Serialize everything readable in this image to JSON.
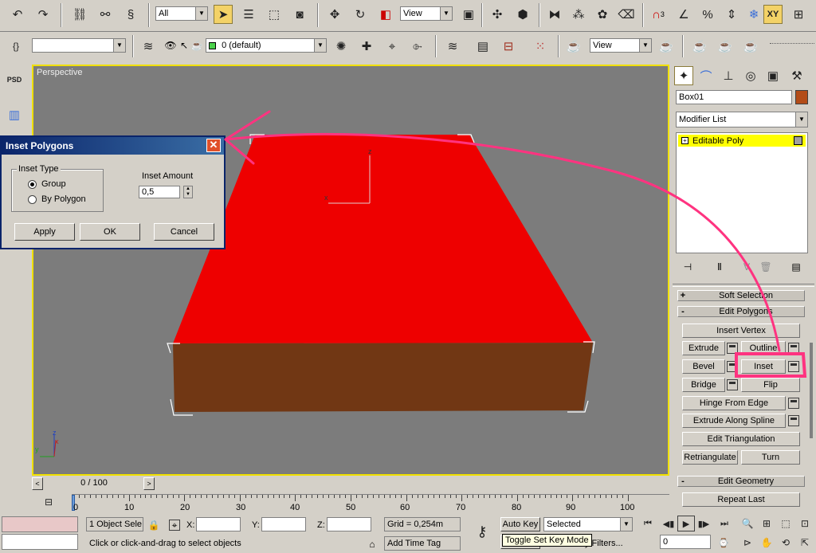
{
  "toolbar1": {
    "selection_filter": "All",
    "ref_coord": "View",
    "icons": [
      "undo-icon",
      "redo-icon",
      "link-icon",
      "unlink-icon",
      "bind-spacewarp-icon",
      "select-icon",
      "select-by-name-icon",
      "rect-region-icon",
      "window-crossing-icon",
      "move-icon",
      "rotate-icon",
      "scale-icon",
      "pivot-icon",
      "manipulate-icon",
      "snap-3-icon",
      "angle-snap-icon",
      "percent-snap-icon",
      "spinner-snap-icon",
      "named-selection-icon",
      "mirror-icon",
      "align-icon",
      "xy-icon",
      "layer-icon"
    ],
    "axis_constraint": "XY",
    "snap_label": "3"
  },
  "toolbar2": {
    "named_selection_set": "",
    "layer_name": "0 (default)",
    "view_combo": "View"
  },
  "viewport": {
    "label": "Perspective",
    "frame_counter": "0 / 100",
    "axis_x": "x",
    "axis_y": "y",
    "axis_z": "z"
  },
  "dialog": {
    "title": "Inset Polygons",
    "group_title": "Inset Type",
    "radio_group": "Group",
    "radio_by_polygon": "By Polygon",
    "amount_label": "Inset Amount",
    "amount_value": "0,5",
    "apply_label": "Apply",
    "ok_label": "OK",
    "cancel_label": "Cancel"
  },
  "command_panel": {
    "object_name": "Box01",
    "object_color": "#b34c18",
    "modifier_list": "Modifier List",
    "stack_item": "Editable Poly",
    "rollout_soft": "Soft Selection",
    "rollout_soft_sign": "+",
    "rollout_edit_polys": "Edit Polygons",
    "rollout_edit_polys_sign": "-",
    "rollout_edit_geom": "Edit Geometry",
    "rollout_edit_geom_sign": "-",
    "insert_vertex": "Insert Vertex",
    "extrude": "Extrude",
    "outline": "Outline",
    "bevel": "Bevel",
    "inset": "Inset",
    "bridge": "Bridge",
    "flip": "Flip",
    "hinge": "Hinge From Edge",
    "extrude_spline": "Extrude Along Spline",
    "edit_tri": "Edit Triangulation",
    "retriangulate": "Retriangulate",
    "turn": "Turn",
    "repeat_last": "Repeat Last"
  },
  "timeline": {
    "ticks": [
      "0",
      "10",
      "20",
      "30",
      "40",
      "50",
      "60",
      "70",
      "80",
      "90",
      "100"
    ]
  },
  "status": {
    "selected_count": "1 Object Sele",
    "x_label": "X:",
    "y_label": "Y:",
    "z_label": "Z:",
    "x_value": "",
    "y_value": "",
    "z_value": "",
    "grid": "Grid = 0,254m",
    "prompt": "Click or click-and-drag to select objects",
    "add_time_tag": "Add Time Tag",
    "auto_key": "Auto Key",
    "set_key_combo": "Selected",
    "tooltip": "Toggle Set Key Mode",
    "key_filters": "y Filters...",
    "frame_value": "0"
  },
  "colors": {
    "top_face": "#ee0000",
    "side_face": "#713714",
    "viewport_bg": "#7c7c7c",
    "viewport_border": "#f0e000",
    "annotation": "#ff3380",
    "stack_highlight": "#ffff00"
  }
}
